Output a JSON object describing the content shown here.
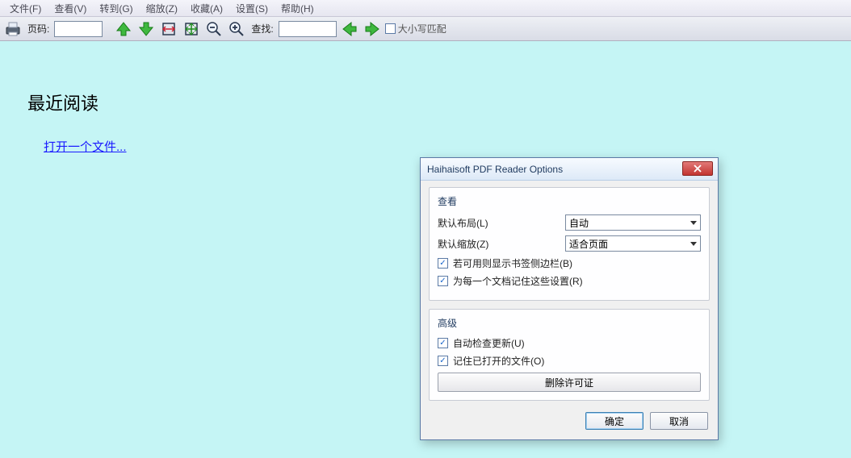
{
  "menubar": {
    "file": "文件(F)",
    "view": "查看(V)",
    "goto": "转到(G)",
    "zoom": "缩放(Z)",
    "favorites": "收藏(A)",
    "settings": "设置(S)",
    "help": "帮助(H)"
  },
  "toolbar": {
    "page_label": "页码:",
    "page_value": "",
    "find_label": "查找:",
    "find_value": "",
    "case_label": "大小写匹配"
  },
  "content": {
    "recent_title": "最近阅读",
    "open_link": "打开一个文件..."
  },
  "dialog": {
    "title": "Haihaisoft PDF Reader Options",
    "view_group": "查看",
    "default_layout_label": "默认布局(L)",
    "default_layout_value": "自动",
    "default_zoom_label": "默认缩放(Z)",
    "default_zoom_value": "适合页面",
    "chk_bookmark": "若可用则显示书签侧边栏(B)",
    "chk_remember_each": "为每一个文档记住这些设置(R)",
    "adv_group": "高级",
    "chk_autoupdate": "自动检查更新(U)",
    "chk_remember_open": "记住已打开的文件(O)",
    "delete_license": "删除许可证",
    "ok": "确定",
    "cancel": "取消"
  }
}
